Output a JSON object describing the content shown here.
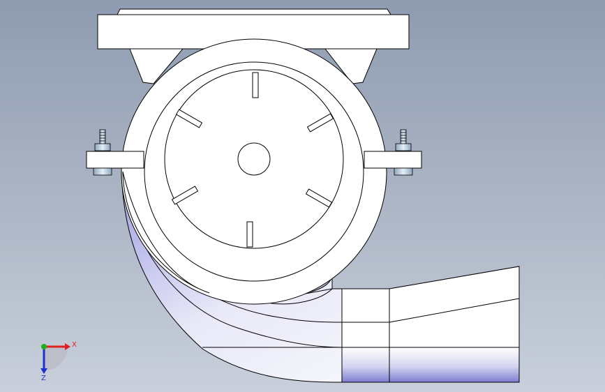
{
  "triad": {
    "x_label": "X",
    "z_label": "Z",
    "x_color": "#e02020",
    "y_color": "#20b020",
    "z_color": "#2030d0"
  },
  "colors": {
    "background_top": "#8e9bb0",
    "background_bottom": "#c9d0dc",
    "part_fill": "#ffffff",
    "edge": "#000000",
    "shading": "#8a8ad8",
    "bolt": "#b7c9da"
  },
  "icons": [
    "flange-plate",
    "volute-casing",
    "impeller-disc",
    "shaft-hole",
    "bolt",
    "discharge-pipe",
    "axis-triad"
  ]
}
